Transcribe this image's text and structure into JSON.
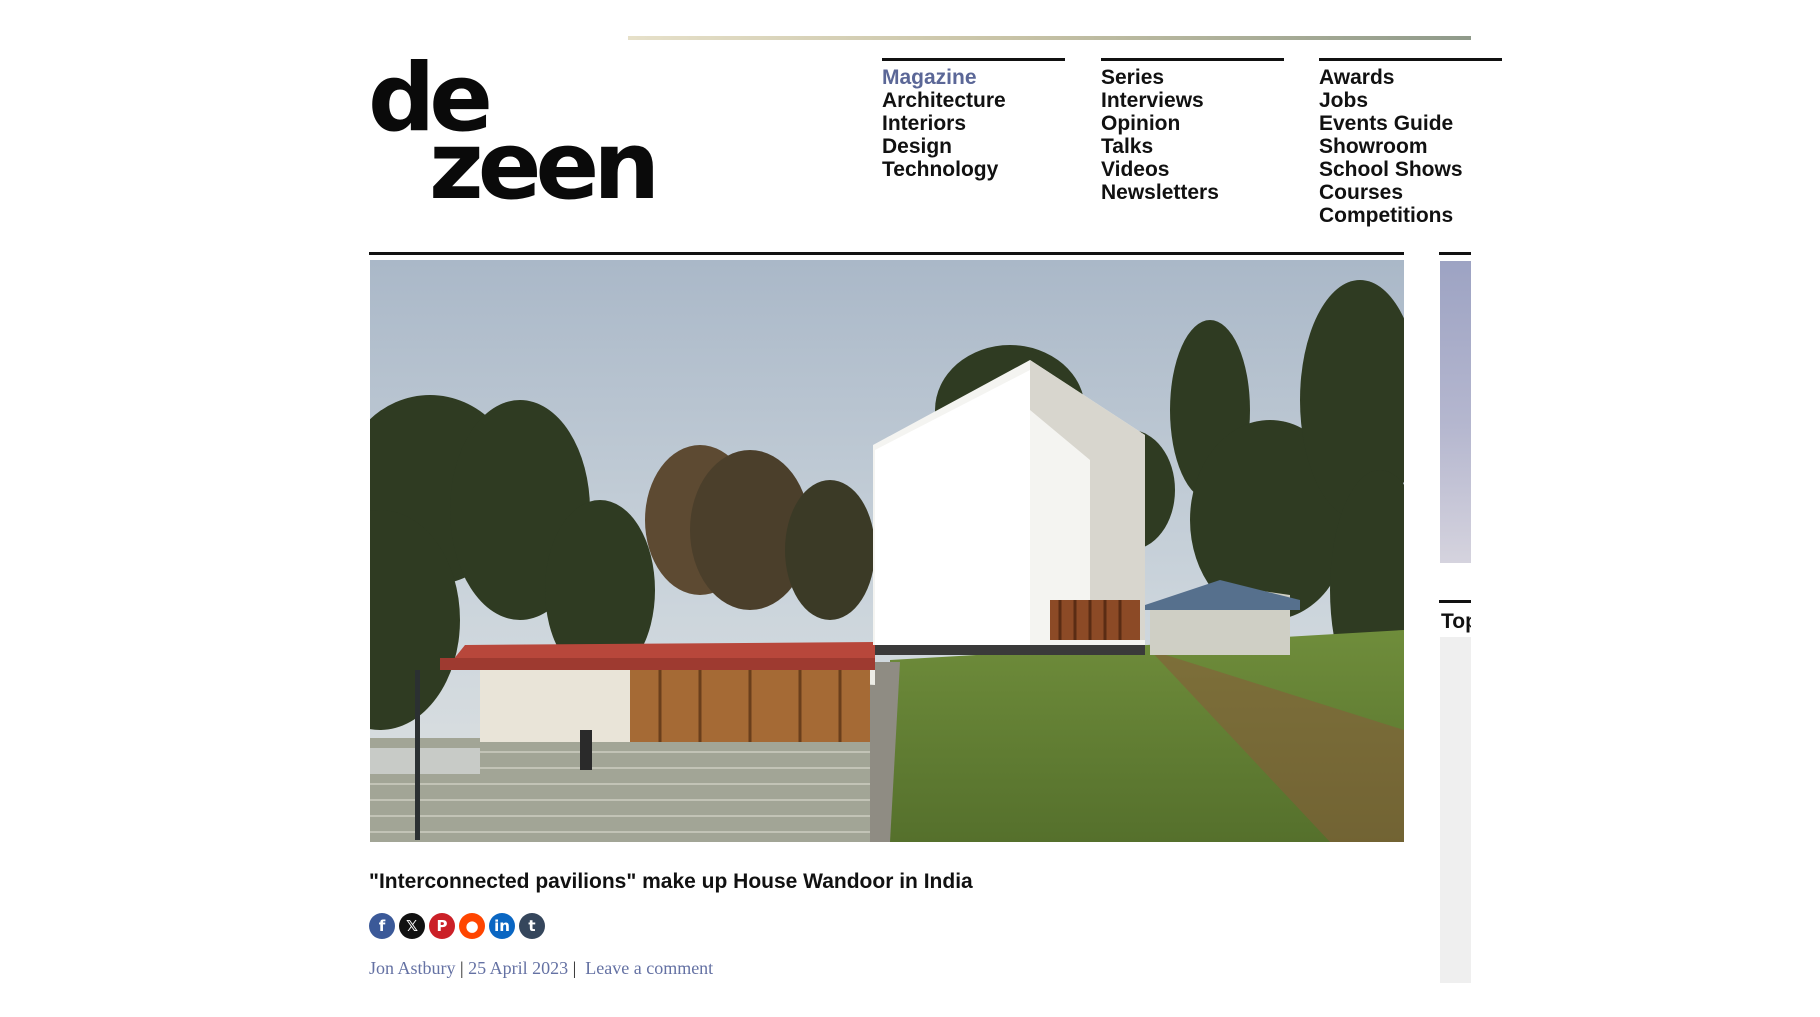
{
  "logo": {
    "line1": "de",
    "line2": "zeen"
  },
  "nav": {
    "col1": [
      "Magazine",
      "Architecture",
      "Interiors",
      "Design",
      "Technology"
    ],
    "col2": [
      "Series",
      "Interviews",
      "Opinion",
      "Talks",
      "Videos",
      "Newsletters"
    ],
    "col3": [
      "Awards",
      "Jobs",
      "Events Guide",
      "Showroom",
      "School Shows",
      "Courses",
      "Competitions"
    ],
    "active": "Magazine"
  },
  "colors": {
    "active_nav": "#5b6797",
    "byline": "#6471a3",
    "text": "#111111"
  },
  "article": {
    "headline": "\"Interconnected pavilions\" make up House Wandoor in India",
    "author": "Jon Astbury",
    "date": "25 April 2023",
    "comment_link": "Leave a comment",
    "byline_separator": "|"
  },
  "share_icons": [
    {
      "name": "facebook-icon",
      "glyph": "f",
      "color": "#3b5998"
    },
    {
      "name": "x-icon",
      "glyph": "𝕏",
      "color": "#111111"
    },
    {
      "name": "pinterest-icon",
      "glyph": "P",
      "color": "#cb2027"
    },
    {
      "name": "reddit-icon",
      "glyph": "●",
      "color": "#ff4500"
    },
    {
      "name": "linkedin-icon",
      "glyph": "in",
      "color": "#0a66c2"
    },
    {
      "name": "tumblr-icon",
      "glyph": "t",
      "color": "#35465c"
    }
  ],
  "sidebar": {
    "heading_partial": "Top"
  }
}
